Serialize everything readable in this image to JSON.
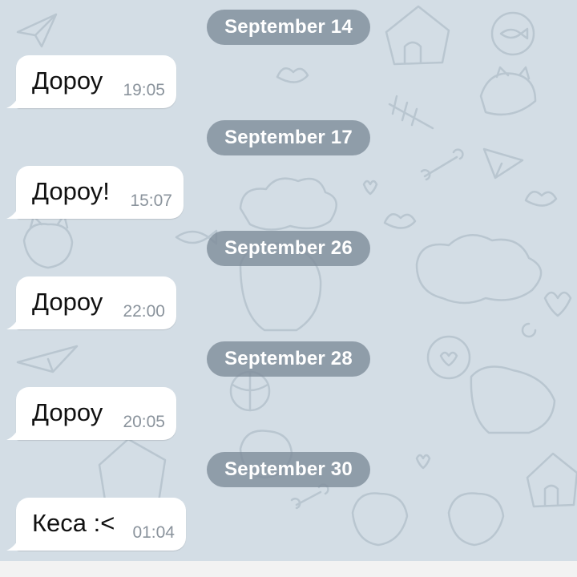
{
  "conversation": [
    {
      "date": "September 14",
      "message": {
        "text": "Дороу",
        "time": "19:05"
      }
    },
    {
      "date": "September 17",
      "message": {
        "text": "Дороу!",
        "time": "15:07"
      }
    },
    {
      "date": "September 26",
      "message": {
        "text": "Дороу",
        "time": "22:00"
      }
    },
    {
      "date": "September 28",
      "message": {
        "text": "Дороу",
        "time": "20:05"
      }
    },
    {
      "date": "September 30",
      "message": {
        "text": "Кеса :<",
        "time": "01:04"
      }
    }
  ],
  "colors": {
    "wallpaper": "#d3dde5",
    "date_pill": "#7c8a98",
    "bubble": "#ffffff",
    "time_text": "#8a939c"
  }
}
